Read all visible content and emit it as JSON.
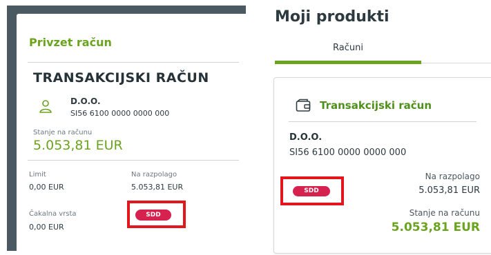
{
  "left": {
    "panel_title": "Privzet račun",
    "account_type": "TRANSAKCIJSKI RAČUN",
    "holder_name": "D.O.O.",
    "iban": "SI56 6100 0000 0000 000",
    "balance_label": "Stanje na računu",
    "balance_value": "5.053,81 EUR",
    "limit_label": "Limit",
    "limit_value": "0,00 EUR",
    "available_label": "Na razpolago",
    "available_value": "5.053,81 EUR",
    "queue_label": "Čakalna vrsta",
    "queue_value": "0,00 EUR",
    "badge": "SDD"
  },
  "right": {
    "heading": "Moji produkti",
    "tab": "Računi",
    "card_title": "Transakcijski račun",
    "holder_name": "D.O.O.",
    "iban": "SI56 6100 0000 0000 000",
    "badge": "SDD",
    "available_label": "Na razpolago",
    "available_value": "5.053,81 EUR",
    "balance_label": "Stanje na računu",
    "balance_value": "5.053,81 EUR"
  },
  "icons": {
    "user": "user-icon",
    "wallet": "wallet-icon"
  },
  "colors": {
    "green": "#6aa31f",
    "badge": "#d6224e",
    "highlight": "#e3161e",
    "frame": "#4a5a60"
  }
}
